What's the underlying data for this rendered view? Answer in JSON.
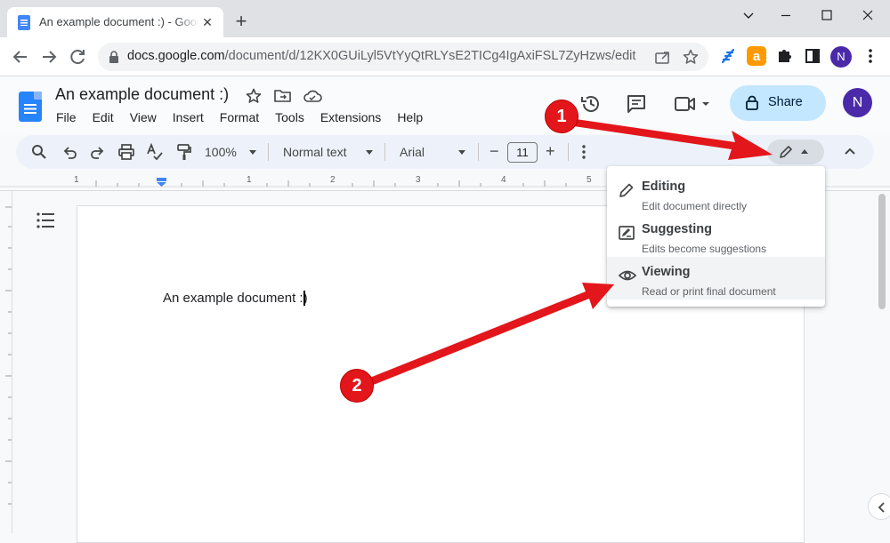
{
  "browser": {
    "tab_title": "An example document :) - Google Docs",
    "tab_close": "✕",
    "new_tab": "+",
    "url_host": "docs.google.com",
    "url_path": "/document/d/12KX0GUiLyl5VtYyQtRLYsE2TICg4IgAxiFSL7ZyHzws/edit",
    "profile_initial": "N"
  },
  "docs": {
    "title": "An example document :)",
    "menu": [
      "File",
      "Edit",
      "View",
      "Insert",
      "Format",
      "Tools",
      "Extensions",
      "Help"
    ],
    "share_label": "Share",
    "avatar_initial": "N"
  },
  "format_toolbar": {
    "zoom": "100%",
    "style": "Normal text",
    "font": "Arial",
    "font_size": "11",
    "minus": "−",
    "plus": "+"
  },
  "ruler": {
    "marks": [
      "1",
      "1",
      "2",
      "3",
      "4",
      "5"
    ]
  },
  "document": {
    "body_text": "An example document :)"
  },
  "mode_menu": {
    "items": [
      {
        "label": "Editing",
        "description": "Edit document directly",
        "icon": "pencil-icon"
      },
      {
        "label": "Suggesting",
        "description": "Edits become suggestions",
        "icon": "suggest-icon"
      },
      {
        "label": "Viewing",
        "description": "Read or print final document",
        "icon": "eye-icon"
      }
    ]
  },
  "annotations": {
    "step1": "1",
    "step2": "2",
    "color": "#e3161b"
  }
}
